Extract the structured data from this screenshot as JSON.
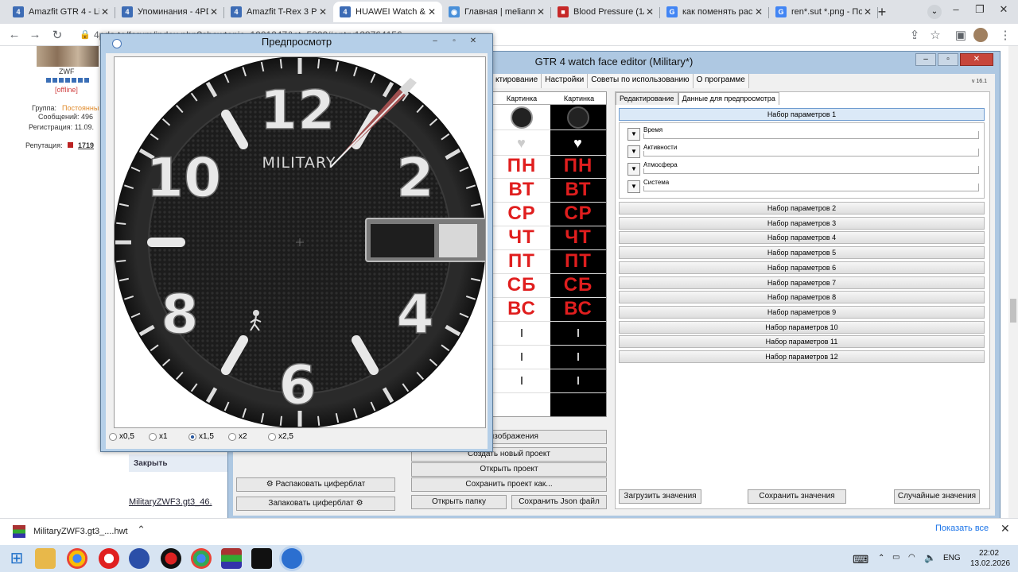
{
  "browser": {
    "tabs": [
      {
        "title": "Amazfit GTR 4 - Li",
        "color": "#3d6cb5",
        "glyph": "4"
      },
      {
        "title": "Упоминания - 4PD",
        "color": "#3d6cb5",
        "glyph": "4"
      },
      {
        "title": "Amazfit T-Rex 3 Pr",
        "color": "#3d6cb5",
        "glyph": "4"
      },
      {
        "title": "HUAWEI Watch &",
        "color": "#3d6cb5",
        "glyph": "4"
      },
      {
        "title": "Главная | melianm",
        "color": "#4a90d9",
        "glyph": "◉"
      },
      {
        "title": "Blood Pressure (1/",
        "color": "#c62828",
        "glyph": "■"
      },
      {
        "title": "как поменять рас",
        "color": "#4285f4",
        "glyph": "G"
      },
      {
        "title": "ren*.sut *.png - По",
        "color": "#4285f4",
        "glyph": "G"
      }
    ],
    "url": "4pda.to/forum/index.php?showtopic=1001247&st=5300#entry128764156"
  },
  "forum": {
    "username": "ZWF",
    "status": "[offline]",
    "group_label": "Группа:",
    "group_value": "Постоянны",
    "messages": "Сообщений: 496",
    "registration": "Регистрация: 11.09.",
    "reputation_label": "Репутация:",
    "reputation_value": "1719",
    "close_label": "Закрыть",
    "attachment": "MilitaryZWF3.gt3_46."
  },
  "editor": {
    "title": "GTR 4 watch face editor (Military*)",
    "version": "v 16.1",
    "menu": [
      "ктирование",
      "Настройки",
      "Советы по использованию",
      "О программе"
    ],
    "table_headers": [
      "Картинка",
      "Картинка"
    ],
    "days": [
      "ПН",
      "ВТ",
      "СР",
      "ЧТ",
      "ПТ",
      "СБ",
      "ВС"
    ],
    "buttons": {
      "images": "ть изображения",
      "new_project": "Создать новый проект",
      "open_project": "Открыть проект",
      "save_project_as": "Сохранить проект как...",
      "open_folder": "Открыть папку",
      "save_json": "Сохранить Json файл",
      "unpack": "Распаковать циферблат",
      "pack": "Запаковать циферблат",
      "load_values": "Загрузить значения",
      "save_values": "Сохранить значения",
      "random_values": "Случайные значения"
    },
    "right_tabs": [
      "Редактирование",
      "Данные для предпросмотра"
    ],
    "param_sets": [
      "Набор параметров 1",
      "Набор параметров 2",
      "Набор параметров 3",
      "Набор параметров 4",
      "Набор параметров 5",
      "Набор параметров 6",
      "Набор параметров 7",
      "Набор параметров 8",
      "Набор параметров 9",
      "Набор параметров 10",
      "Набор параметров 11",
      "Набор параметров 12"
    ],
    "groups": [
      "Время",
      "Активности",
      "Атмосфера",
      "Система"
    ]
  },
  "preview": {
    "title": "Предпросмотр",
    "brand": "MILITARY",
    "numerals": [
      "12",
      "2",
      "4",
      "6",
      "8",
      "10"
    ],
    "zoom_options": [
      "x0,5",
      "x1",
      "x1,5",
      "x2",
      "x2,5"
    ],
    "zoom_selected": "x1,5"
  },
  "download": {
    "filename": "MilitaryZWF3.gt3_....hwt",
    "show_all": "Показать все"
  },
  "taskbar": {
    "lang": "ENG",
    "time": "22:02",
    "date": "13.02.2026"
  }
}
